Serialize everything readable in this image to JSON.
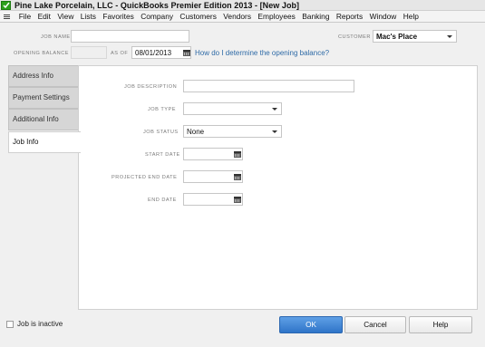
{
  "window": {
    "title": "Pine Lake Porcelain, LLC  - QuickBooks Premier Edition 2013 - [New Job]"
  },
  "menu": [
    "File",
    "Edit",
    "View",
    "Lists",
    "Favorites",
    "Company",
    "Customers",
    "Vendors",
    "Employees",
    "Banking",
    "Reports",
    "Window",
    "Help"
  ],
  "header": {
    "job_name_label": "JOB NAME",
    "job_name_value": "",
    "customer_label": "CUSTOMER",
    "customer_value": "Mac's Place",
    "opening_balance_label": "OPENING BALANCE",
    "opening_balance_value": "",
    "as_of_label": "AS OF",
    "as_of_value": "08/01/2013",
    "help_link": "How do I determine the opening balance?"
  },
  "tabs": [
    {
      "label": "Address Info",
      "active": false
    },
    {
      "label": "Payment Settings",
      "active": false
    },
    {
      "label": "Additional Info",
      "active": false
    },
    {
      "label": "Job Info",
      "active": true
    }
  ],
  "job_info": {
    "description_label": "JOB DESCRIPTION",
    "description_value": "",
    "type_label": "JOB TYPE",
    "type_value": "",
    "status_label": "JOB STATUS",
    "status_value": "None",
    "start_label": "START DATE",
    "start_value": "",
    "projected_end_label": "PROJECTED END DATE",
    "projected_end_value": "",
    "end_label": "END DATE",
    "end_value": ""
  },
  "footer": {
    "inactive_label": "Job is inactive",
    "inactive_checked": false,
    "ok_label": "OK",
    "cancel_label": "Cancel",
    "help_label": "Help"
  },
  "colors": {
    "accent": "#2f74c8",
    "link": "#2e6aa6",
    "brand": "#2ca01c"
  }
}
